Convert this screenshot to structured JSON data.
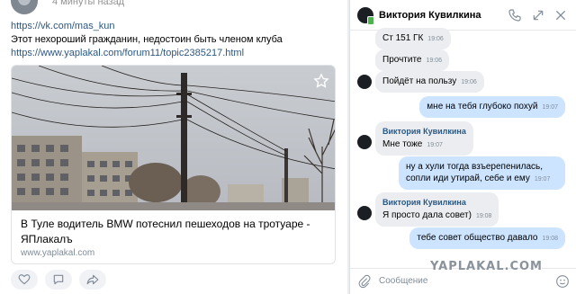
{
  "post": {
    "time": "4 минуты назад",
    "link1": "https://vk.com/mas_kun",
    "text": "Этот нехороший гражданин, недостоин быть членом клуба",
    "link2": "https://www.yaplakal.com/forum11/topic2385217.html",
    "card": {
      "title": "В Туле водитель BMW потеснил пешеходов на тротуаре - ЯПлакалъ",
      "domain": "www.yaplakal.com"
    }
  },
  "chat": {
    "name": "Виктория Кувилкина",
    "messages": [
      {
        "dir": "in",
        "text": "Ст 151 ГК",
        "time": "19:06"
      },
      {
        "dir": "in",
        "text": "Прочтите",
        "time": "19:06"
      },
      {
        "dir": "in",
        "text": "Пойдёт на пользу",
        "time": "19:06"
      },
      {
        "dir": "out",
        "text": "мне на тебя глубоко похуй",
        "time": "19:07"
      },
      {
        "dir": "in",
        "author": "Виктория Кувилкина",
        "text": "Мне тоже",
        "time": "19:07"
      },
      {
        "dir": "out",
        "text": "ну а хули тогда взъерепенилась, сопли иди утирай, себе и ему",
        "time": "19:07"
      },
      {
        "dir": "in",
        "author": "Виктория Кувилкина",
        "text": "Я просто дала совет)",
        "time": "19:08"
      },
      {
        "dir": "out",
        "text": "тебе совет общество давало",
        "time": "19:08"
      }
    ],
    "composer_placeholder": "Сообщение"
  },
  "watermark": "YAPLAKAL.COM",
  "colors": {
    "link": "#2a5885",
    "bubble_in": "#ebedf0",
    "bubble_out": "#cce4ff",
    "online": "#4bb34b"
  }
}
